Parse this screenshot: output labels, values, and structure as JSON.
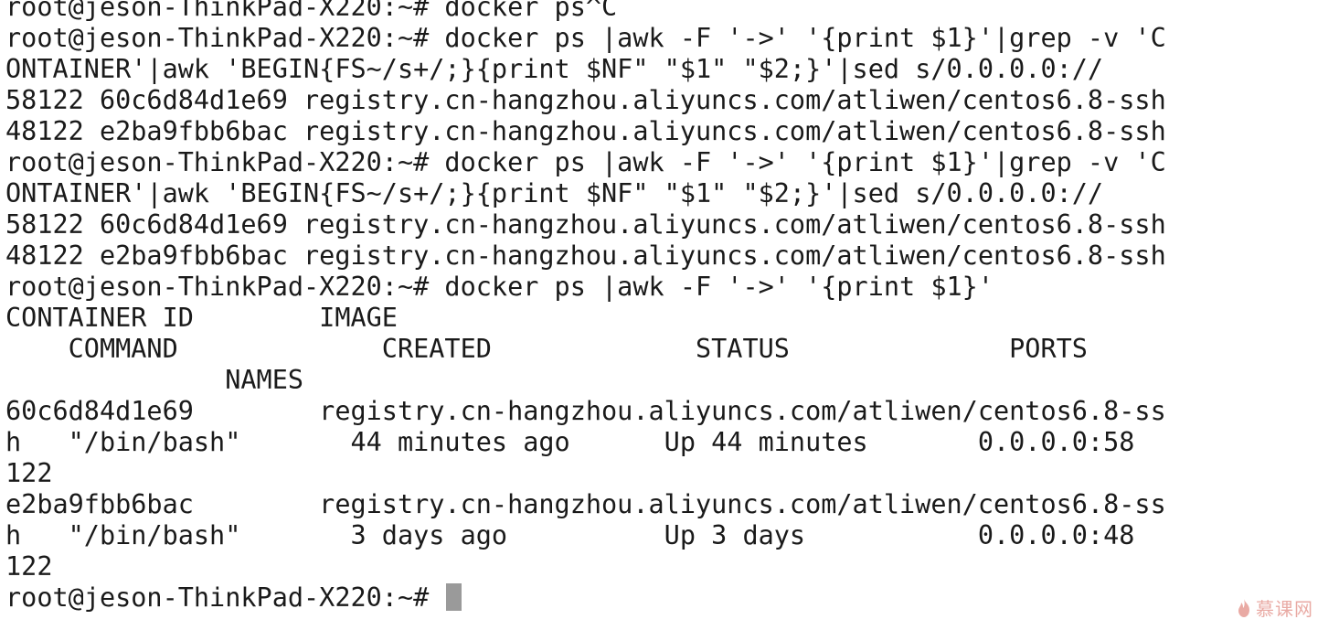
{
  "terminal": {
    "lines": [
      "root@jeson-ThinkPad-X220:~# docker ps^C",
      "root@jeson-ThinkPad-X220:~# docker ps |awk -F '->' '{print $1}'|grep -v 'C",
      "ONTAINER'|awk 'BEGIN{FS~/s+/;}{print $NF\" \"$1\" \"$2;}'|sed s/0.0.0.0://",
      "58122 60c6d84d1e69 registry.cn-hangzhou.aliyuncs.com/atliwen/centos6.8-ssh",
      "48122 e2ba9fbb6bac registry.cn-hangzhou.aliyuncs.com/atliwen/centos6.8-ssh",
      "root@jeson-ThinkPad-X220:~# docker ps |awk -F '->' '{print $1}'|grep -v 'C",
      "ONTAINER'|awk 'BEGIN{FS~/s+/;}{print $NF\" \"$1\" \"$2;}'|sed s/0.0.0.0://",
      "58122 60c6d84d1e69 registry.cn-hangzhou.aliyuncs.com/atliwen/centos6.8-ssh",
      "48122 e2ba9fbb6bac registry.cn-hangzhou.aliyuncs.com/atliwen/centos6.8-ssh",
      "root@jeson-ThinkPad-X220:~# docker ps |awk -F '->' '{print $1}'",
      "CONTAINER ID        IMAGE",
      "    COMMAND             CREATED             STATUS              PORTS",
      "              NAMES",
      "60c6d84d1e69        registry.cn-hangzhou.aliyuncs.com/atliwen/centos6.8-ss",
      "h   \"/bin/bash\"       44 minutes ago      Up 44 minutes       0.0.0.0:58",
      "122",
      "e2ba9fbb6bac        registry.cn-hangzhou.aliyuncs.com/atliwen/centos6.8-ss",
      "h   \"/bin/bash\"       3 days ago          Up 3 days           0.0.0.0:48",
      "122"
    ],
    "prompt": "root@jeson-ThinkPad-X220:~# "
  },
  "watermark": {
    "text": "慕课网",
    "icon": "flame-icon",
    "color": "#d8665a"
  },
  "colors": {
    "background": "#ffffff",
    "foreground": "#1a1a1a",
    "cursor": "#9a9a9a"
  }
}
